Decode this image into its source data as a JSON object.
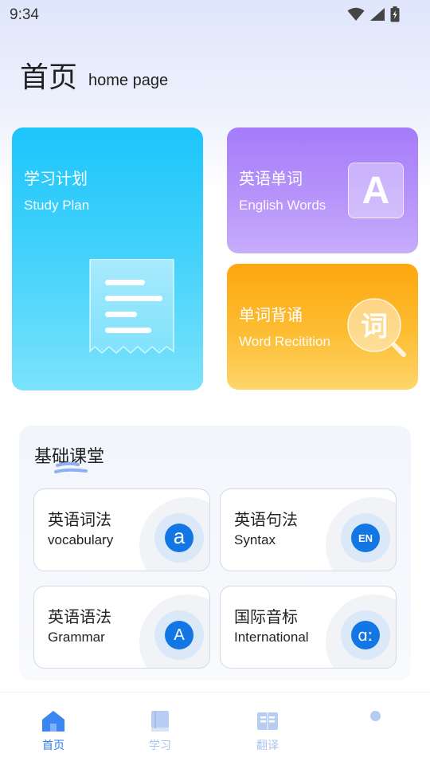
{
  "status_bar": {
    "time": "9:34",
    "icons": [
      "wifi-icon",
      "signal-icon",
      "battery-charging-icon"
    ]
  },
  "header": {
    "title": "首页",
    "subtitle": "home page"
  },
  "cards": {
    "study_plan": {
      "title": "学习计划",
      "subtitle": "Study Plan",
      "icon": "document-icon",
      "color": "#1dc5fb"
    },
    "english_words": {
      "title": "英语单词",
      "subtitle": "English Words",
      "icon": "letter-a-icon",
      "icon_text": "A",
      "color": "#a57bfa"
    },
    "word_recitation": {
      "title": "单词背诵",
      "subtitle": "Word Recitition",
      "icon": "magnifier-word-icon",
      "icon_text": "词",
      "color": "#fda70e"
    }
  },
  "basic_class": {
    "title": "基础课堂",
    "items": [
      {
        "title": "英语词法",
        "subtitle": "vocabulary",
        "icon": "letter-a-lowercase-icon",
        "glyph": "a"
      },
      {
        "title": "英语句法",
        "subtitle": "Syntax",
        "icon": "en-icon",
        "glyph": "EN"
      },
      {
        "title": "英语语法",
        "subtitle": "Grammar",
        "icon": "letter-a-uppercase-icon",
        "glyph": "A"
      },
      {
        "title": "国际音标",
        "subtitle": "International",
        "icon": "phonetic-icon",
        "glyph": "ɑː"
      }
    ]
  },
  "bottom_nav": {
    "items": [
      {
        "label": "首页",
        "icon": "home-icon",
        "active": true
      },
      {
        "label": "学习",
        "icon": "book-icon",
        "active": false
      },
      {
        "label": "翻译",
        "icon": "translate-icon",
        "active": false
      }
    ],
    "accent": "#2c7ef2",
    "inactive": "#a9c4ef"
  }
}
